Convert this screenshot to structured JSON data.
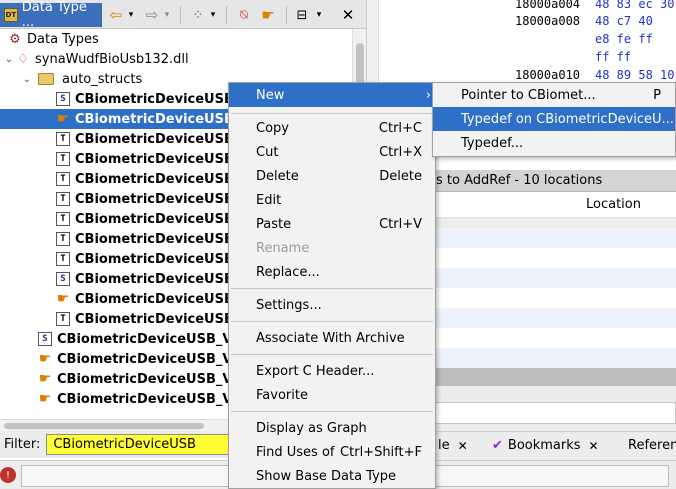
{
  "left_panel": {
    "tab_title": "Data Type ...",
    "tree": {
      "root": "Data Types",
      "archive": "synaWudfBioUsb132.dll",
      "folder": "auto_structs",
      "rows": [
        {
          "label": "CBiometricDeviceUSB",
          "icon": "struct-icon"
        },
        {
          "label": "CBiometricDeviceUSB",
          "icon": "pointer-hand-icon"
        },
        {
          "label": "CBiometricDeviceUSB",
          "icon": "typedef-icon"
        },
        {
          "label": "CBiometricDeviceUSB",
          "icon": "typedef-icon"
        },
        {
          "label": "CBiometricDeviceUSB",
          "icon": "typedef-icon"
        },
        {
          "label": "CBiometricDeviceUSB",
          "icon": "typedef-icon"
        },
        {
          "label": "CBiometricDeviceUSB",
          "icon": "typedef-icon"
        },
        {
          "label": "CBiometricDeviceUSB",
          "icon": "typedef-icon"
        },
        {
          "label": "CBiometricDeviceUSB",
          "icon": "typedef-icon"
        },
        {
          "label": "CBiometricDeviceUSB",
          "icon": "struct-icon"
        },
        {
          "label": "CBiometricDeviceUSB",
          "icon": "pointer-hand-icon"
        },
        {
          "label": "CBiometricDeviceUSB",
          "icon": "typedef-icon"
        }
      ],
      "outer_rows": [
        {
          "label": "CBiometricDeviceUSB_Vt",
          "icon": "struct-icon"
        },
        {
          "label": "CBiometricDeviceUSB_Vt",
          "icon": "pointer-hand-icon"
        },
        {
          "label": "CBiometricDeviceUSB_Vt",
          "icon": "pointer-hand-icon"
        },
        {
          "label": "CBiometricDeviceUSB_Vt",
          "icon": "pointer-hand-icon"
        }
      ]
    },
    "filter": {
      "label": "Filter:",
      "value": "CBiometricDeviceUSB"
    }
  },
  "listing": {
    "lines": [
      {
        "addr": "18000a004",
        "bytes": "48 83 ec 30"
      },
      {
        "addr": "18000a008",
        "bytes": "48 c7 40"
      },
      {
        "addr": "",
        "bytes": "e8 fe ff"
      },
      {
        "addr": "",
        "bytes": "ff ff"
      },
      {
        "addr": "18000a010",
        "bytes": "48 89 58 10"
      }
    ]
  },
  "references": {
    "header": "s to AddRef - 10 locations",
    "column_location": "Location"
  },
  "bottom_tabs": {
    "tab1": "le",
    "bookmarks": "Bookmarks",
    "tab3": "Referen"
  },
  "context_menu": {
    "items": [
      {
        "label": "New",
        "shortcut": "",
        "submenu": true
      },
      {
        "label": "Copy",
        "shortcut": "Ctrl+C"
      },
      {
        "label": "Cut",
        "shortcut": "Ctrl+X"
      },
      {
        "label": "Delete",
        "shortcut": "Delete"
      },
      {
        "label": "Edit",
        "shortcut": ""
      },
      {
        "label": "Paste",
        "shortcut": "Ctrl+V"
      },
      {
        "label": "Rename",
        "shortcut": "",
        "disabled": true
      },
      {
        "label": "Replace...",
        "shortcut": ""
      },
      {
        "label": "Settings...",
        "shortcut": ""
      },
      {
        "label": "Associate With Archive",
        "shortcut": ""
      },
      {
        "label": "Export C Header...",
        "shortcut": ""
      },
      {
        "label": "Favorite",
        "shortcut": ""
      },
      {
        "label": "Display as Graph",
        "shortcut": ""
      },
      {
        "label": "Find Uses of",
        "shortcut": "Ctrl+Shift+F"
      },
      {
        "label": "Show Base Data Type",
        "shortcut": ""
      }
    ],
    "submenu_arrow": "›"
  },
  "sub_menu": {
    "items": [
      {
        "label": "Pointer to CBiomet...",
        "shortcut": "P"
      },
      {
        "label": "Typedef on CBiometricDeviceU...",
        "shortcut": ""
      },
      {
        "label": "Typedef...",
        "shortcut": ""
      }
    ]
  },
  "colors": {
    "selection": "#2e6fc8",
    "filter_bg": "#ffff33",
    "tab_active": "#3c6fb9"
  }
}
